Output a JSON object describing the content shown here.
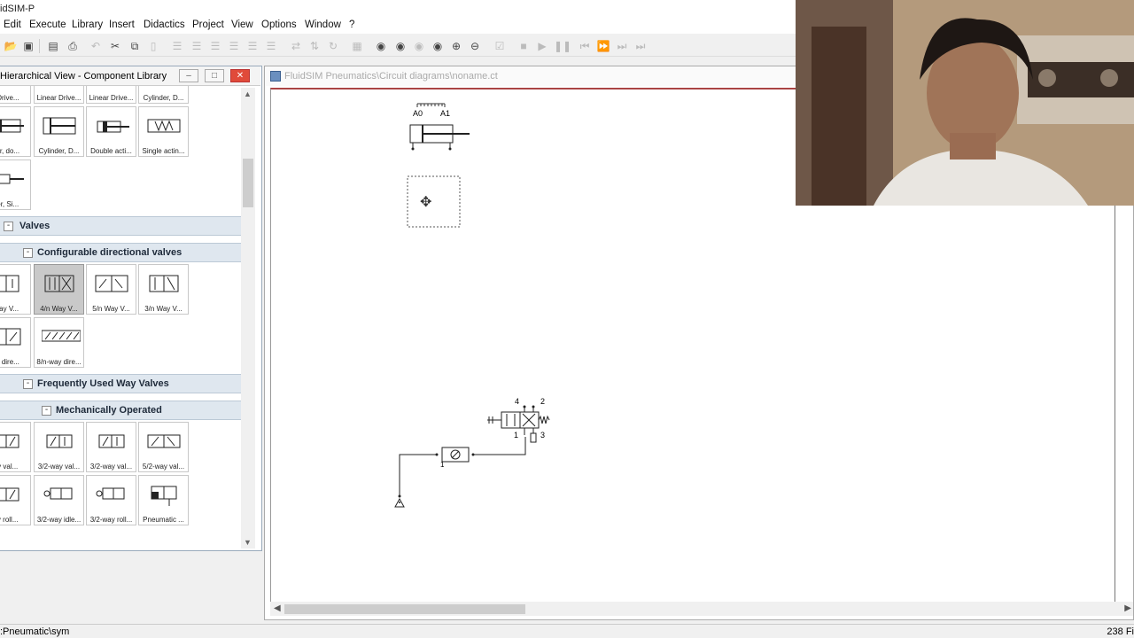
{
  "app": {
    "title": "idSIM-P"
  },
  "menu": [
    "Edit",
    "Execute",
    "Library",
    "Insert",
    "Didactics",
    "Project",
    "View",
    "Options",
    "Window",
    "?"
  ],
  "library": {
    "title": "Hierarchical View - Component Library",
    "top_row_labels": [
      "r Drive...",
      "Linear Drive...",
      "Linear Drive...",
      "Cylinder, D..."
    ],
    "row1": [
      "der, do...",
      "Cylinder, D...",
      "Double acti...",
      "Single actin..."
    ],
    "row2": [
      "der, Si..."
    ],
    "valves_header": "Valves",
    "config_header": "Configurable directional valves",
    "config_row1": [
      "Way V...",
      "4/n Way V...",
      "5/n Way V...",
      "3/n Way V..."
    ],
    "config_row2": [
      "ay dire...",
      "8/n-way dire..."
    ],
    "freq_header": "Frequently Used Way Valves",
    "mech_header": "Mechanically Operated",
    "mech_row1": [
      "ay val...",
      "3/2-way val...",
      "3/2-way val...",
      "5/2-way val..."
    ],
    "mech_row2": [
      "ay roll...",
      "3/2-way idle...",
      "3/2-way roll...",
      "Pneumatic ..."
    ]
  },
  "circuit": {
    "title": "FluidSIM Pneumatics\\Circuit diagrams\\noname.ct",
    "cyl_labels": [
      "A0",
      "A1"
    ],
    "valve_ports": [
      "4",
      "2",
      "1",
      "3"
    ],
    "source_port": "1"
  },
  "status": {
    "left": ":Pneumatic\\sym",
    "right": "238 Fi"
  }
}
